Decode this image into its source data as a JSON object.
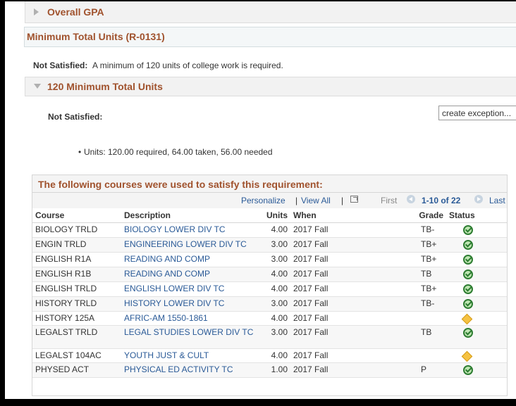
{
  "overall_gpa": {
    "label": "Overall GPA"
  },
  "requirement": {
    "title": "Minimum Total Units (R-0131)"
  },
  "requirement_status": {
    "label": "Not Satisfied:",
    "text": "A minimum of 120 units of college work is required."
  },
  "subrequirement": {
    "title": "120 Minimum Total Units"
  },
  "sub_status": {
    "label": "Not Satisfied:",
    "exception_button": "create exception..."
  },
  "units_summary": "Units: 120.00 required, 64.00 taken, 56.00 needed",
  "courses_grid": {
    "title": "The following courses were used to satisfy this requirement:",
    "personalize": "Personalize",
    "separator": "|",
    "view_all": "View All",
    "first": "First",
    "range": "1-10 of 22",
    "last": "Last",
    "headers": {
      "course": "Course",
      "description": "Description",
      "units": "Units",
      "when": "When",
      "grade": "Grade",
      "status": "Status"
    },
    "rows": [
      {
        "course": "BIOLOGY TRLD",
        "description": "BIOLOGY LOWER DIV TC",
        "units": "4.00",
        "when": "2017 Fall",
        "grade": "TB-",
        "status": "satisfied-icon"
      },
      {
        "course": "ENGIN TRLD",
        "description": "ENGINEERING LOWER DIV TC",
        "units": "3.00",
        "when": "2017 Fall",
        "grade": "TB+",
        "status": "satisfied-icon"
      },
      {
        "course": "ENGLISH R1A",
        "description": "READING AND COMP",
        "units": "3.00",
        "when": "2017 Fall",
        "grade": "TB+",
        "status": "satisfied-icon"
      },
      {
        "course": "ENGLISH R1B",
        "description": "READING AND COMP",
        "units": "4.00",
        "when": "2017 Fall",
        "grade": "TB",
        "status": "satisfied-icon"
      },
      {
        "course": "ENGLISH TRLD",
        "description": "ENGLISH LOWER DIV TC",
        "units": "4.00",
        "when": "2017 Fall",
        "grade": "TB+",
        "status": "satisfied-icon"
      },
      {
        "course": "HISTORY TRLD",
        "description": "HISTORY LOWER DIV TC",
        "units": "3.00",
        "when": "2017 Fall",
        "grade": "TB-",
        "status": "satisfied-icon"
      },
      {
        "course": "HISTORY 125A",
        "description": "AFRIC-AM 1550-1861",
        "units": "4.00",
        "when": "2017 Fall",
        "grade": "",
        "status": "in-progress-icon"
      },
      {
        "course": "LEGALST TRLD",
        "description": "LEGAL STUDIES LOWER DIV TC",
        "units": "3.00",
        "when": "2017 Fall",
        "grade": "TB",
        "status": "satisfied-icon"
      },
      {
        "course": "LEGALST 104AC",
        "description": "YOUTH JUST & CULT",
        "units": "4.00",
        "when": "2017 Fall",
        "grade": "",
        "status": "in-progress-icon"
      },
      {
        "course": "PHYSED ACT",
        "description": "PHYSICAL ED ACTIVITY TC",
        "units": "1.00",
        "when": "2017 Fall",
        "grade": "P",
        "status": "satisfied-icon"
      }
    ]
  },
  "colors": {
    "section_title": "#a0522d",
    "link": "#2a5a97",
    "satisfied": "#2e7d32",
    "in_progress": "#f5c242"
  }
}
